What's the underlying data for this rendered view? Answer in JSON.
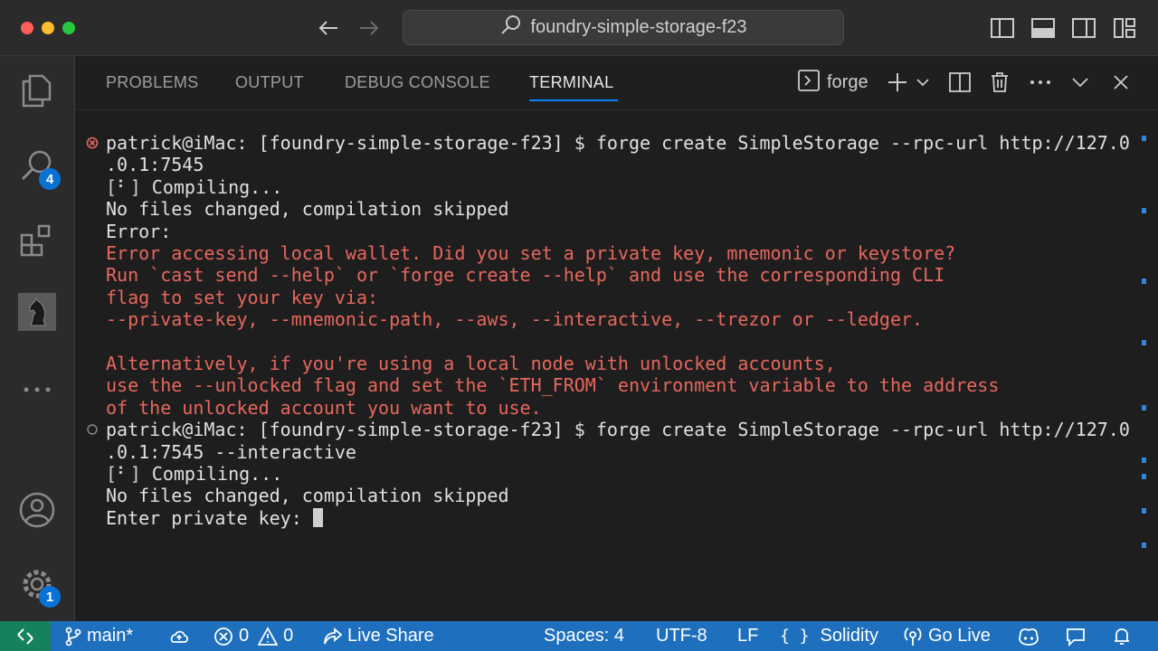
{
  "titlebar": {
    "search_text": "foundry-simple-storage-f23"
  },
  "activity": {
    "search_badge": "4",
    "settings_badge": "1"
  },
  "panel": {
    "tabs": [
      "PROBLEMS",
      "OUTPUT",
      "DEBUG CONSOLE",
      "TERMINAL"
    ],
    "active_tab": "TERMINAL",
    "terminal_name": "forge"
  },
  "terminal": {
    "lines": [
      {
        "text": "patrick@iMac: [foundry-simple-storage-f23] $ forge create SimpleStorage --rpc-url http://127.0",
        "style": "normal",
        "marker": "error"
      },
      {
        "text": ".0.1:7545",
        "style": "normal"
      },
      {
        "spinner": "[⠃]",
        "text": " Compiling...",
        "style": "normal"
      },
      {
        "text": "No files changed, compilation skipped",
        "style": "normal"
      },
      {
        "text": "Error:",
        "style": "normal"
      },
      {
        "text": "Error accessing local wallet. Did you set a private key, mnemonic or keystore?",
        "style": "error"
      },
      {
        "text": "Run `cast send --help` or `forge create --help` and use the corresponding CLI",
        "style": "error"
      },
      {
        "text": "flag to set your key via:",
        "style": "error"
      },
      {
        "text": "--private-key, --mnemonic-path, --aws, --interactive, --trezor or --ledger.",
        "style": "error"
      },
      {
        "text": "",
        "style": "normal"
      },
      {
        "text": "Alternatively, if you're using a local node with unlocked accounts,",
        "style": "error"
      },
      {
        "text": "use the --unlocked flag and set the `ETH_FROM` environment variable to the address",
        "style": "error"
      },
      {
        "text": "of the unlocked account you want to use.",
        "style": "error"
      },
      {
        "text": "patrick@iMac: [foundry-simple-storage-f23] $ forge create SimpleStorage --rpc-url http://127.0",
        "style": "normal",
        "marker": "pending"
      },
      {
        "text": ".0.1:7545 --interactive",
        "style": "normal"
      },
      {
        "spinner": "[⠃]",
        "text": " Compiling...",
        "style": "normal"
      },
      {
        "text": "No files changed, compilation skipped",
        "style": "normal"
      },
      {
        "text": "Enter private key: ",
        "style": "normal",
        "cursor": true
      }
    ]
  },
  "statusbar": {
    "branch": "main*",
    "errors": "0",
    "warnings": "0",
    "live_share": "Live Share",
    "spaces": "Spaces: 4",
    "encoding": "UTF-8",
    "eol": "LF",
    "language": "Solidity",
    "go_live": "Go Live"
  },
  "colors": {
    "accent": "#1e6fbd",
    "remote": "#16825d",
    "error_text": "#e7675d",
    "badge": "#0a72d4"
  }
}
